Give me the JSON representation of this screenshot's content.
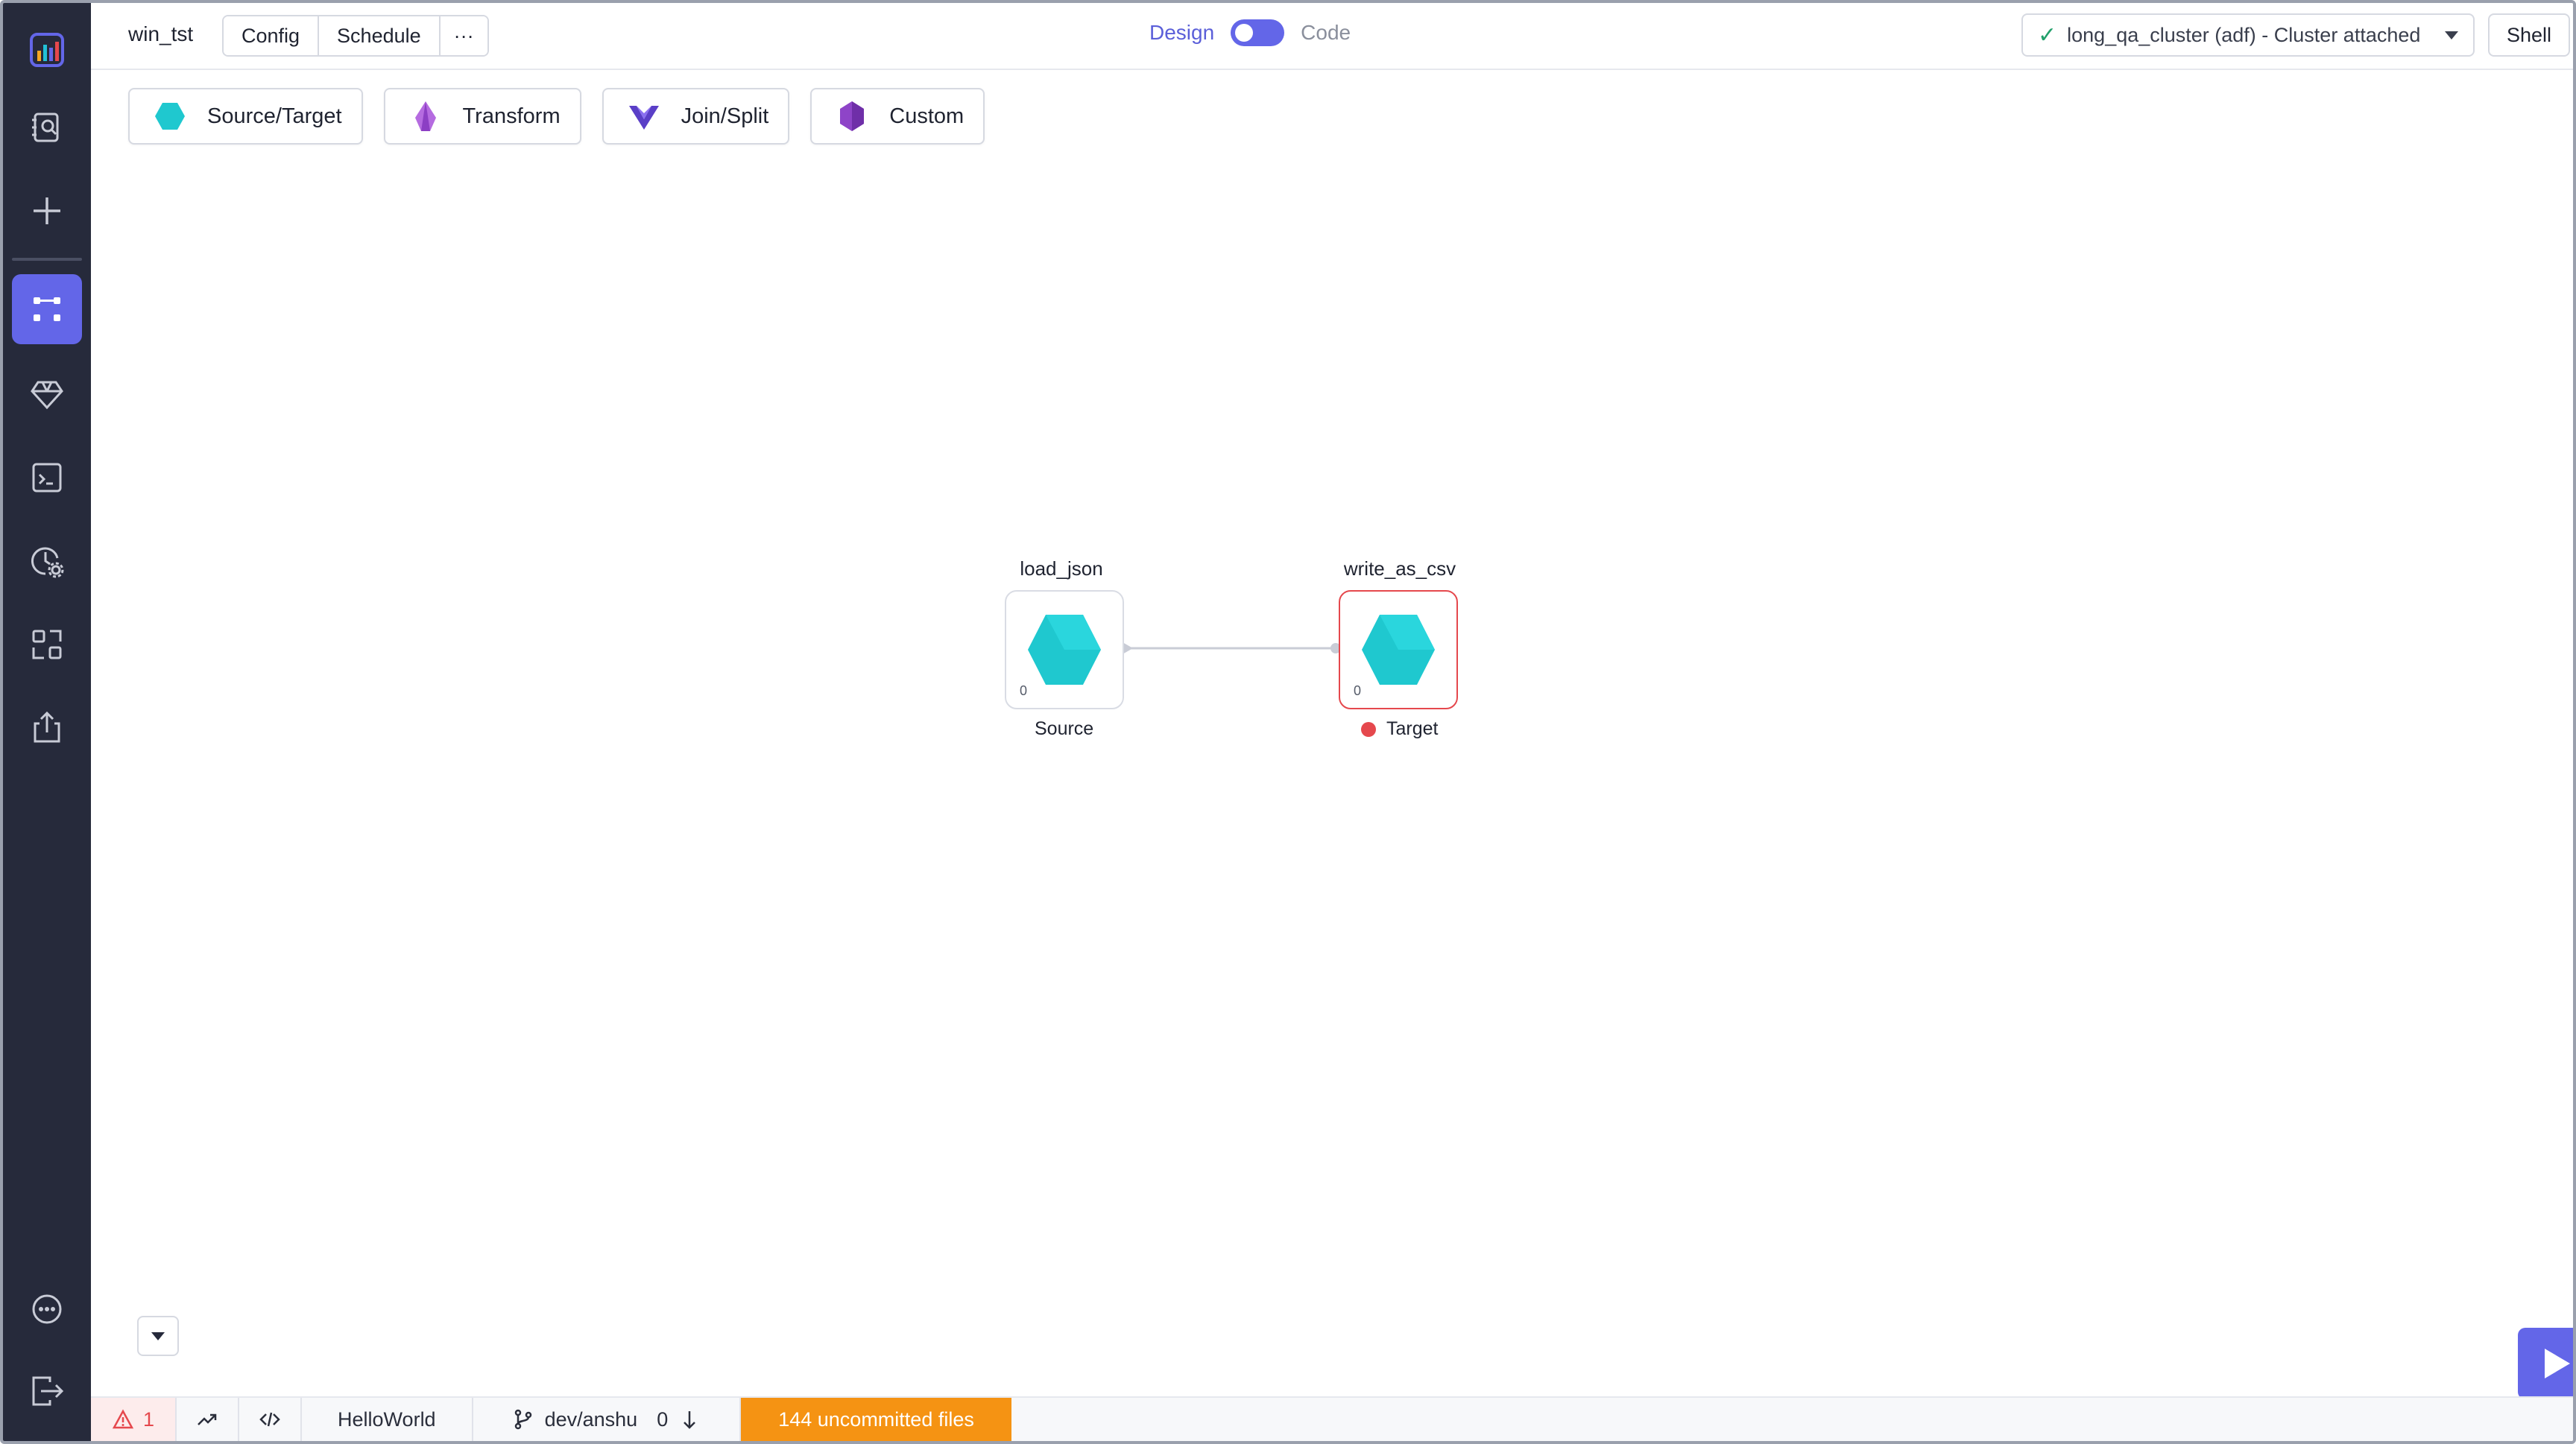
{
  "app": {
    "logo_icon": "analytics-logo-icon",
    "accent_color": "#6366e8"
  },
  "sidebar": {
    "items": [
      {
        "name": "search-docs-icon"
      },
      {
        "name": "plus-icon"
      },
      {
        "name": "pipeline-graph-icon",
        "active": true
      },
      {
        "name": "gem-icon"
      },
      {
        "name": "terminal-icon"
      },
      {
        "name": "schedule-settings-icon"
      },
      {
        "name": "dependencies-icon"
      },
      {
        "name": "upload-icon"
      },
      {
        "name": "more-icon"
      },
      {
        "name": "logout-icon"
      }
    ]
  },
  "header": {
    "pipeline_name": "win_tst",
    "tabs": [
      "Config",
      "Schedule"
    ],
    "more_label": "···",
    "design_label": "Design",
    "code_label": "Code",
    "cluster_label": "long_qa_cluster (adf) - Cluster attached",
    "cluster_status_icon": "check-icon",
    "shell_label": "Shell"
  },
  "gem_toolbar": [
    {
      "label": "Source/Target",
      "icon": "hexagon-cyan-icon",
      "color": "#1fc8cf"
    },
    {
      "label": "Transform",
      "icon": "gem-purple-icon",
      "color": "#a35bd8"
    },
    {
      "label": "Join/Split",
      "icon": "chevron-merge-icon",
      "color": "#5a3fc7"
    },
    {
      "label": "Custom",
      "icon": "hexagon-violet-icon",
      "color": "#8e44c8"
    }
  ],
  "nodes": [
    {
      "title": "load_json",
      "type": "Source",
      "count": "0",
      "status": "ok",
      "color": "#1fc8cf"
    },
    {
      "title": "write_as_csv",
      "type": "Target",
      "count": "0",
      "status": "error",
      "color": "#1fc8cf"
    }
  ],
  "statusbar": {
    "warnings": "1",
    "project": "HelloWorld",
    "branch": "dev/anshu",
    "pull_count": "0",
    "uncommitted": "144 uncommitted files"
  }
}
